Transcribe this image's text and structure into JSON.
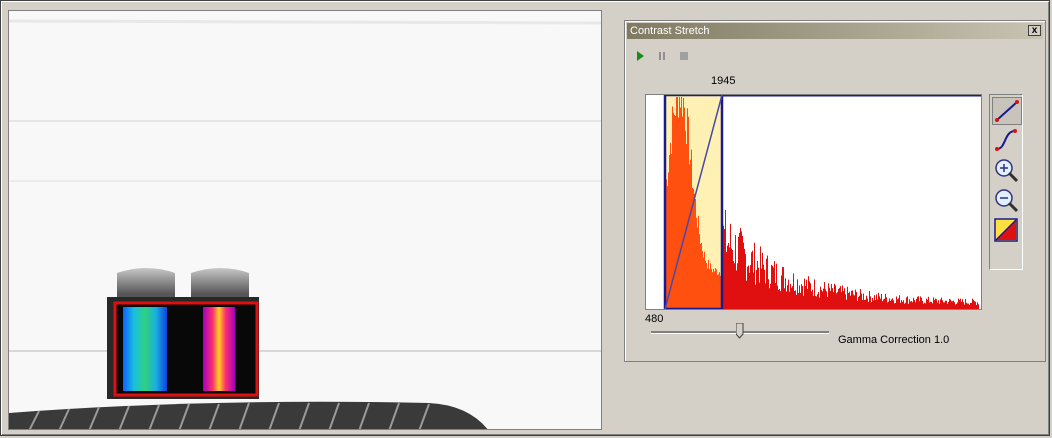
{
  "panel": {
    "title": "Contrast Stretch",
    "close_label": "x",
    "toolbar": {
      "play_icon": "play-icon",
      "pause_icon": "pause-icon",
      "stop_icon": "stop-icon"
    },
    "histogram": {
      "upper_value": "1945",
      "lower_value": "480"
    },
    "gamma": {
      "label": "Gamma Correction 1.0",
      "value": 1.0,
      "slider_fraction": 0.5
    },
    "side_tools": [
      {
        "name": "linear-stretch-icon"
      },
      {
        "name": "curve-stretch-icon"
      },
      {
        "name": "zoom-in-icon"
      },
      {
        "name": "zoom-out-icon"
      },
      {
        "name": "auto-stretch-icon"
      }
    ]
  },
  "image": {
    "roi_color": "#e01010",
    "histogram_color": "#e01010",
    "selection_color": "#1a1a8c"
  }
}
